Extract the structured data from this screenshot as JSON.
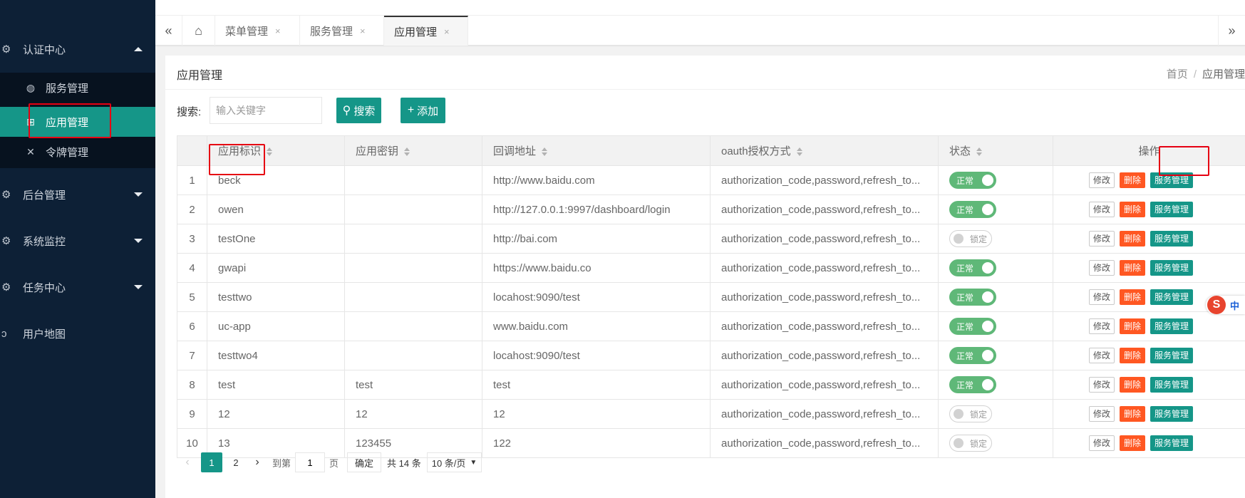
{
  "sidebar": {
    "groups": [
      {
        "label": "认证中心",
        "expanded": true
      },
      {
        "label": "后台管理",
        "expanded": false
      },
      {
        "label": "系统监控",
        "expanded": false
      },
      {
        "label": "任务中心",
        "expanded": false
      },
      {
        "label": "用户地图",
        "expanded": false
      }
    ],
    "sub_items": [
      {
        "label": "服务管理",
        "active": false
      },
      {
        "label": "应用管理",
        "active": true
      },
      {
        "label": "令牌管理",
        "active": false
      }
    ]
  },
  "tabs": [
    {
      "label": "菜单管理",
      "active": false
    },
    {
      "label": "服务管理",
      "active": false
    },
    {
      "label": "应用管理",
      "active": true
    }
  ],
  "tab_close_glyph": "×",
  "page": {
    "title": "应用管理",
    "breadcrumb": {
      "home": "首页",
      "separator": "/",
      "current": "应用管理"
    }
  },
  "search": {
    "label": "搜索:",
    "placeholder": "输入关键字",
    "button_label": "搜索",
    "add_label": "添加"
  },
  "table": {
    "headers": [
      "应用标识",
      "应用密钥",
      "回调地址",
      "oauth授权方式",
      "状态",
      "操作"
    ],
    "rows": [
      {
        "no": "1",
        "client_id": "beck",
        "secret": "",
        "redirect": "http://www.baidu.com",
        "grant": "authorization_code,password,refresh_to...",
        "status": "正常",
        "enabled": true
      },
      {
        "no": "2",
        "client_id": "owen",
        "secret": "",
        "redirect": "http://127.0.0.1:9997/dashboard/login",
        "grant": "authorization_code,password,refresh_to...",
        "status": "正常",
        "enabled": true
      },
      {
        "no": "3",
        "client_id": "testOne",
        "secret": "",
        "redirect": "http://bai.com",
        "grant": "authorization_code,password,refresh_to...",
        "status": "锁定",
        "enabled": false
      },
      {
        "no": "4",
        "client_id": "gwapi",
        "secret": "",
        "redirect": "https://www.baidu.co",
        "grant": "authorization_code,password,refresh_to...",
        "status": "正常",
        "enabled": true
      },
      {
        "no": "5",
        "client_id": "testtwo",
        "secret": "",
        "redirect": "locahost:9090/test",
        "grant": "authorization_code,password,refresh_to...",
        "status": "正常",
        "enabled": true
      },
      {
        "no": "6",
        "client_id": "uc-app",
        "secret": "",
        "redirect": "www.baidu.com",
        "grant": "authorization_code,password,refresh_to...",
        "status": "正常",
        "enabled": true
      },
      {
        "no": "7",
        "client_id": "testtwo4",
        "secret": "",
        "redirect": "locahost:9090/test",
        "grant": "authorization_code,password,refresh_to...",
        "status": "正常",
        "enabled": true
      },
      {
        "no": "8",
        "client_id": "test",
        "secret": "test",
        "redirect": "test",
        "grant": "authorization_code,password,refresh_to...",
        "status": "正常",
        "enabled": true
      },
      {
        "no": "9",
        "client_id": "12",
        "secret": "12",
        "redirect": "12",
        "grant": "authorization_code,password,refresh_to...",
        "status": "锁定",
        "enabled": false
      },
      {
        "no": "10",
        "client_id": "13",
        "secret": "123455",
        "redirect": "122",
        "grant": "authorization_code,password,refresh_to...",
        "status": "锁定",
        "enabled": false
      }
    ],
    "actions": {
      "edit": "修改",
      "delete": "删除",
      "service": "服务管理"
    }
  },
  "pagination": {
    "pages": [
      "1",
      "2"
    ],
    "current": "1",
    "goto_label": "到第",
    "goto_value": "1",
    "page_unit": "页",
    "confirm": "确定",
    "total": "共 14 条",
    "page_size": "10 条/页"
  },
  "ime": {
    "logo": "S",
    "mode": "中"
  },
  "colors": {
    "primary": "#159688",
    "sidebar": "#0d2036",
    "danger": "#ff5722",
    "success": "#5fb878",
    "highlight": "#e60012"
  }
}
